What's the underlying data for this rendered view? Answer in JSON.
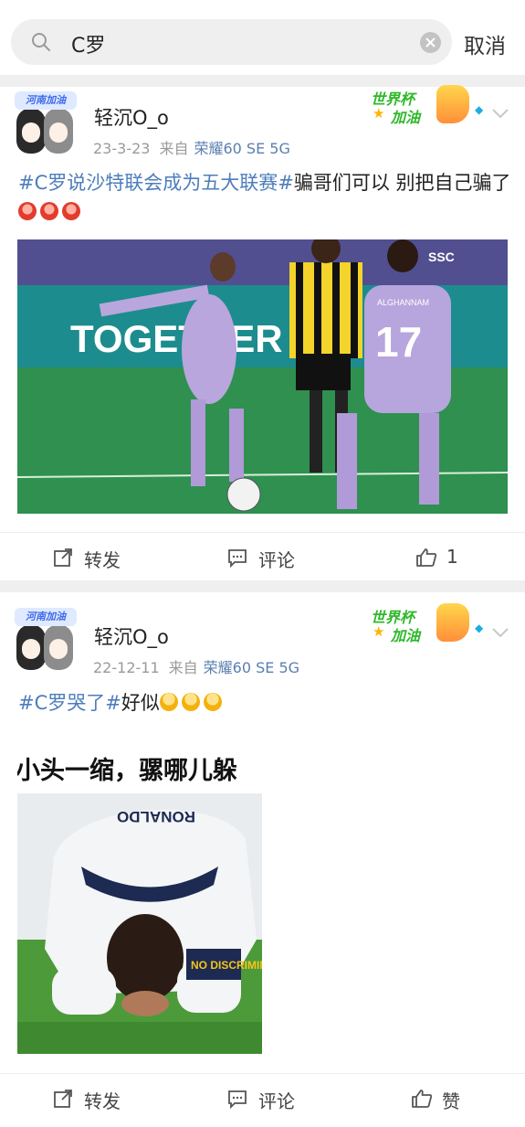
{
  "search": {
    "query": "C罗",
    "cancel_label": "取消"
  },
  "colors": {
    "topic": "#4d7dbb",
    "source": "#5b7fb0",
    "separator": "#efefef"
  },
  "posts": [
    {
      "avatar_banner": "河南加油",
      "username": "轻沉O_o",
      "date": "23-3-23",
      "from_prefix": "来自",
      "source": "荣耀60 SE 5G",
      "badge_line1": "世界杯",
      "badge_line2": "加油",
      "topic": "#C罗说沙特联会成为五大联赛#",
      "body": "骗哥们可以 别把自己骗了",
      "emoji_count": 3,
      "image": {
        "banner_text": "TOGETHER",
        "broadcaster": "SSC",
        "player_number": "17",
        "player_name": "ALGHANNAM"
      },
      "repost_label": "转发",
      "comment_label": "评论",
      "like_label": "1"
    },
    {
      "avatar_banner": "河南加油",
      "username": "轻沉O_o",
      "date": "22-12-11",
      "from_prefix": "来自",
      "source": "荣耀60 SE 5G",
      "badge_line1": "世界杯",
      "badge_line2": "加油",
      "topic": "#C罗哭了#",
      "body": "好似",
      "emoji_count": 3,
      "image": {
        "caption": "小头一缩，骡哪儿躲",
        "jersey_name": "RONALDO",
        "armband": "NO DISCRIMINATION"
      },
      "repost_label": "转发",
      "comment_label": "评论",
      "like_label": "赞"
    }
  ]
}
